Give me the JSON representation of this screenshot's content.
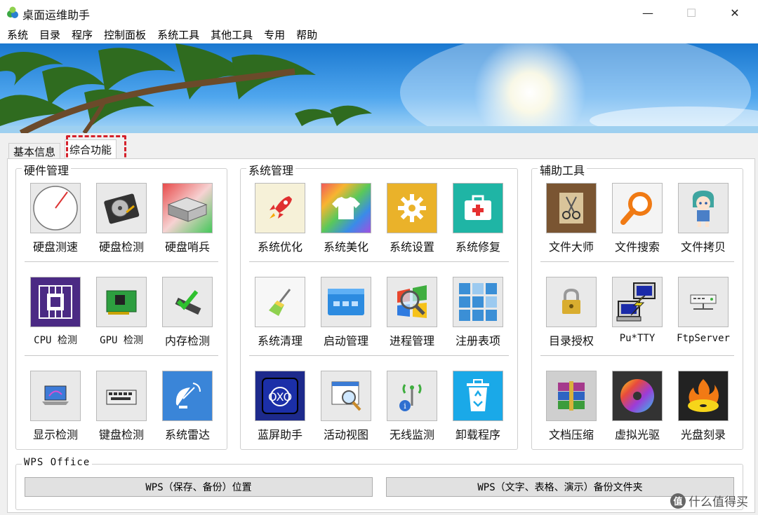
{
  "window": {
    "title": "桌面运维助手",
    "minimize_glyph": "—",
    "maximize_glyph": "☐",
    "close_glyph": "✕"
  },
  "menu": [
    "系统",
    "目录",
    "程序",
    "控制面板",
    "系统工具",
    "其他工具",
    "专用",
    "帮助"
  ],
  "tabs": {
    "basic": "基本信息",
    "combined": "综合功能"
  },
  "groups": {
    "hardware": {
      "title": "硬件管理",
      "tools": [
        {
          "label": "硬盘测速",
          "icon": "speed-gauge-icon"
        },
        {
          "label": "硬盘检测",
          "icon": "hard-disk-icon"
        },
        {
          "label": "硬盘哨兵",
          "icon": "disk-sentinel-icon"
        },
        {
          "label": "CPU 检测",
          "icon": "cpu-chip-icon"
        },
        {
          "label": "GPU 检测",
          "icon": "graphics-card-icon"
        },
        {
          "label": "内存检测",
          "icon": "memory-check-icon"
        },
        {
          "label": "显示检测",
          "icon": "laptop-display-icon"
        },
        {
          "label": "键盘检测",
          "icon": "keyboard-icon"
        },
        {
          "label": "系统雷达",
          "icon": "satellite-dish-icon"
        }
      ]
    },
    "system": {
      "title": "系统管理",
      "tools": [
        {
          "label": "系统优化",
          "icon": "rocket-icon"
        },
        {
          "label": "系统美化",
          "icon": "tshirt-icon"
        },
        {
          "label": "系统设置",
          "icon": "gear-icon"
        },
        {
          "label": "系统修复",
          "icon": "first-aid-kit-icon"
        },
        {
          "label": "系统清理",
          "icon": "broom-icon"
        },
        {
          "label": "启动管理",
          "icon": "startup-window-icon"
        },
        {
          "label": "进程管理",
          "icon": "process-magnifier-icon"
        },
        {
          "label": "注册表项",
          "icon": "registry-blocks-icon"
        },
        {
          "label": "蓝屏助手",
          "icon": "bluescreen-icon"
        },
        {
          "label": "活动视图",
          "icon": "activity-view-icon"
        },
        {
          "label": "无线监测",
          "icon": "wireless-info-icon"
        },
        {
          "label": "卸载程序",
          "icon": "recycle-bin-icon"
        }
      ]
    },
    "auxiliary": {
      "title": "辅助工具",
      "tools": [
        {
          "label": "文件大师",
          "icon": "scissors-folder-icon"
        },
        {
          "label": "文件搜索",
          "icon": "search-icon"
        },
        {
          "label": "文件拷贝",
          "icon": "anime-character-icon"
        },
        {
          "label": "目录授权",
          "icon": "padlock-icon"
        },
        {
          "label": "Pu*TTY",
          "icon": "putty-terminal-icon"
        },
        {
          "label": "FtpServer",
          "icon": "ftp-server-icon"
        },
        {
          "label": "文档压缩",
          "icon": "archive-books-icon"
        },
        {
          "label": "虚拟光驱",
          "icon": "virtual-disc-icon"
        },
        {
          "label": "光盘刻录",
          "icon": "burning-disc-icon"
        }
      ]
    },
    "wps": {
      "title": "WPS Office",
      "button1": "WPS（保存、备份）位置",
      "button2": "WPS（文字、表格、演示）备份文件夹"
    }
  },
  "watermark": {
    "badge": "值",
    "text": "什么值得买"
  },
  "colors": {
    "tab_highlight": "#d4202a",
    "panel_bg": "#f0f0f0",
    "icon_bg": "#e9e9e9"
  }
}
